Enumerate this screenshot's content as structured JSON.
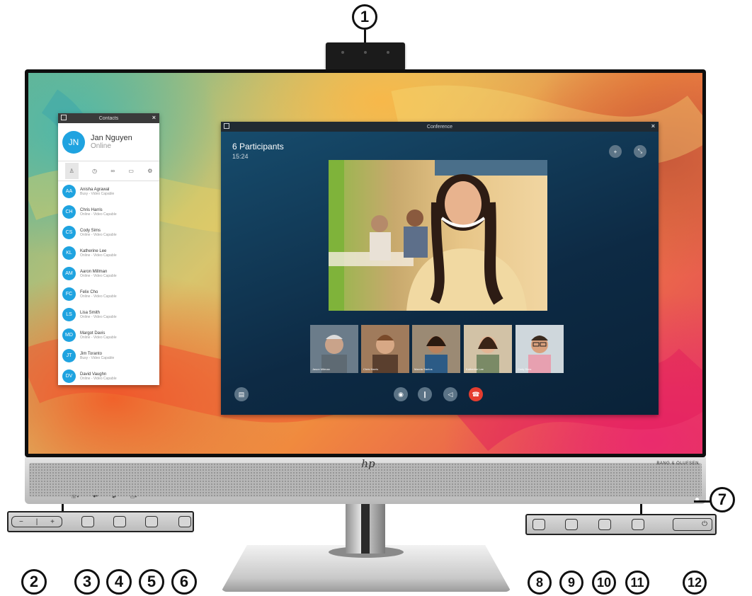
{
  "callouts": [
    "1",
    "2",
    "3",
    "4",
    "5",
    "6",
    "7",
    "8",
    "9",
    "10",
    "11",
    "12"
  ],
  "monitor": {
    "logo": "hp",
    "audio_brand": "BANG & OLUFSEN",
    "front_icons": [
      "phone-icon",
      "mic-icon",
      "speaker-icon",
      "camera-icon"
    ]
  },
  "contacts_window": {
    "title": "Contacts",
    "user": {
      "initials": "JN",
      "name": "Jan Nguyen",
      "status": "Online"
    },
    "tab_icons": [
      "person-icon",
      "clock-icon",
      "link-icon",
      "calendar-icon",
      "gear-icon"
    ],
    "contacts": [
      {
        "initials": "AA",
        "name": "Anisha Agrawal",
        "status": "Busy - Video Capable"
      },
      {
        "initials": "CH",
        "name": "Chris Harris",
        "status": "Online - Video Capable"
      },
      {
        "initials": "CS",
        "name": "Cody Sims",
        "status": "Online - Video Capable"
      },
      {
        "initials": "KL",
        "name": "Katherine Lee",
        "status": "Online - Video Capable"
      },
      {
        "initials": "AM",
        "name": "Aaron Millman",
        "status": "Online - Video Capable"
      },
      {
        "initials": "FC",
        "name": "Felix Cho",
        "status": "Online - Video Capable"
      },
      {
        "initials": "LS",
        "name": "Lisa Smith",
        "status": "Online - Video Capable"
      },
      {
        "initials": "MD",
        "name": "Margot Davis",
        "status": "Online - Video Capable"
      },
      {
        "initials": "JT",
        "name": "Jim Toranto",
        "status": "Busy - Video Capable"
      },
      {
        "initials": "DV",
        "name": "David Vaughn",
        "status": "Online - Video Capable"
      }
    ]
  },
  "conference_window": {
    "title": "Conference",
    "participants": "6 Participants",
    "time": "15:24",
    "thumbnails": [
      "Jason Mitman",
      "Chris Harris",
      "Marcia Santos",
      "Katherine Lee",
      "Cody Sims"
    ],
    "controls": [
      "camera-icon",
      "mic-icon",
      "volume-icon",
      "hangup-icon"
    ]
  },
  "colors": {
    "avatar": "#1fa3e0",
    "hangup": "#e53d2f",
    "conference_bg": "#0d2a44"
  }
}
